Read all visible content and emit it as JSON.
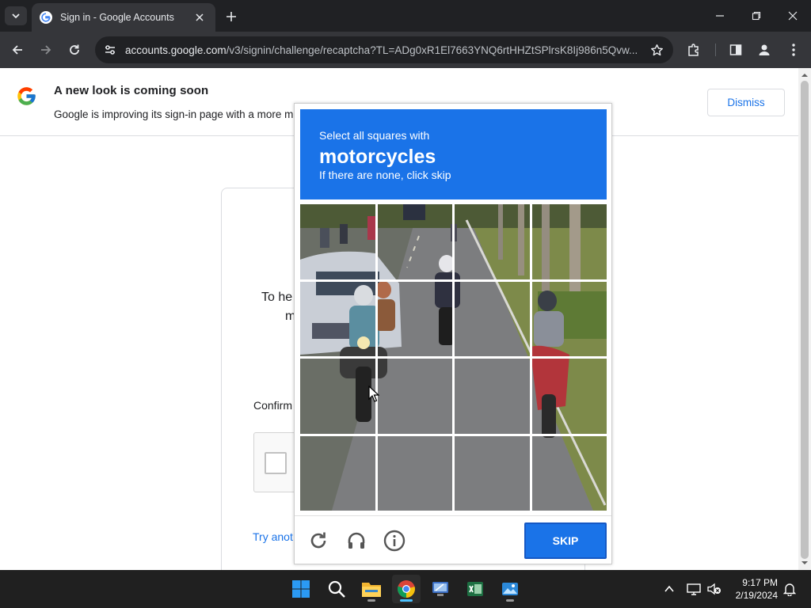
{
  "browser": {
    "tab_title": "Sign in - Google Accounts",
    "url_host": "accounts.google.com",
    "url_rest": "/v3/signin/challenge/recaptcha?TL=ADg0xR1El7663YNQ6rtHHZtSPlrsK8Ij986n5Qvw..."
  },
  "banner": {
    "title": "A new look is coming soon",
    "text": "Google is improving its sign-in page with a more m",
    "dismiss_label": "Dismiss"
  },
  "signin": {
    "help_line1": "To he",
    "help_line2": "m",
    "confirm_text": "Confirm",
    "try_another": "Try anot"
  },
  "recaptcha": {
    "instruction": "Select all squares with",
    "target": "motorcycles",
    "hint": "If there are none, click skip",
    "skip_label": "SKIP",
    "grid_rows": 4,
    "grid_cols": 4,
    "accent_color": "#1a73e8"
  },
  "taskbar": {
    "time": "9:17 PM",
    "date": "2/19/2024",
    "apps": [
      "start-icon",
      "search-icon",
      "file-explorer-icon",
      "chrome-icon",
      "remote-desktop-icon",
      "excel-icon",
      "photos-icon"
    ]
  }
}
